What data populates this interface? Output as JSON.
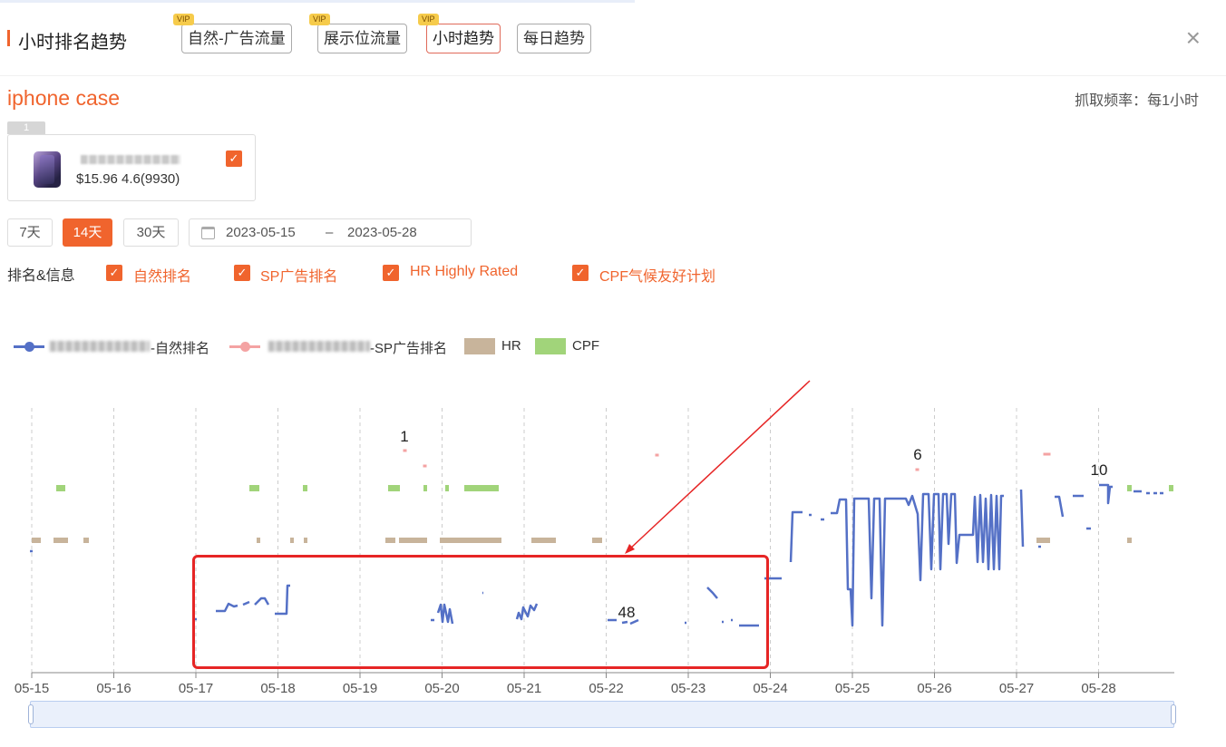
{
  "header": {
    "title": "小时排名趋势",
    "tabs": [
      {
        "label": "自然-广告流量",
        "vip": "VIP",
        "active": false
      },
      {
        "label": "展示位流量",
        "vip": "VIP",
        "active": false
      },
      {
        "label": "小时趋势",
        "vip": "VIP",
        "active": true
      },
      {
        "label": "每日趋势",
        "vip": "",
        "active": false
      }
    ],
    "close_label": "×"
  },
  "keyword": "iphone case",
  "frequency": "抓取频率：每1小时",
  "product": {
    "index": "1",
    "price_rating": "$15.96 4.6(9930)",
    "checked": true
  },
  "ranges": [
    {
      "label": "7天",
      "active": false
    },
    {
      "label": "14天",
      "active": true
    },
    {
      "label": "30天",
      "active": false
    }
  ],
  "date_range": {
    "start": "2023-05-15",
    "sep": "–",
    "end": "2023-05-28"
  },
  "filters": {
    "label": "排名&信息",
    "items": [
      "自然排名",
      "SP广告排名",
      "HR Highly Rated",
      "CPF气候友好计划"
    ]
  },
  "legend": {
    "organic": "-自然排名",
    "sp": "-SP广告排名",
    "hr": "HR",
    "cpf": "CPF"
  },
  "colors": {
    "accent": "#f0642d",
    "organic": "#5470c6",
    "sp": "#f4a3a3",
    "hr": "#c8b49b",
    "cpf": "#a1d47a",
    "highlight": "#e62525"
  },
  "chart_data": {
    "type": "line",
    "xlabel": "",
    "ylabel": "",
    "x_ticks": [
      "05-15",
      "05-16",
      "05-17",
      "05-18",
      "05-19",
      "05-20",
      "05-21",
      "05-22",
      "05-23",
      "05-24",
      "05-25",
      "05-26",
      "05-27",
      "05-28"
    ],
    "y_axis": "rank, inverted (rank 1 at top)",
    "annotations": [
      {
        "x": "05-19 14:00",
        "label": "1"
      },
      {
        "x": "05-25 19:00",
        "label": "6"
      },
      {
        "x": "05-22 05:00",
        "label": "48"
      },
      {
        "x": "05-28 00:00",
        "label": "10"
      }
    ],
    "highlight_region": {
      "x_from": "05-17",
      "x_to": "05-24"
    },
    "series": [
      {
        "name": "-自然排名",
        "note": "organic rank, mostly 40-50 during 05-17..05-23, rising to ~5-30 after 05-24"
      },
      {
        "name": "-SP广告排名",
        "note": "sparse ad rank points: 1, 6, 10"
      },
      {
        "name": "HR",
        "note": "Highly Rated flag present on many hours"
      },
      {
        "name": "CPF",
        "note": "Climate Pledge Friendly flag present on some hours"
      }
    ]
  }
}
